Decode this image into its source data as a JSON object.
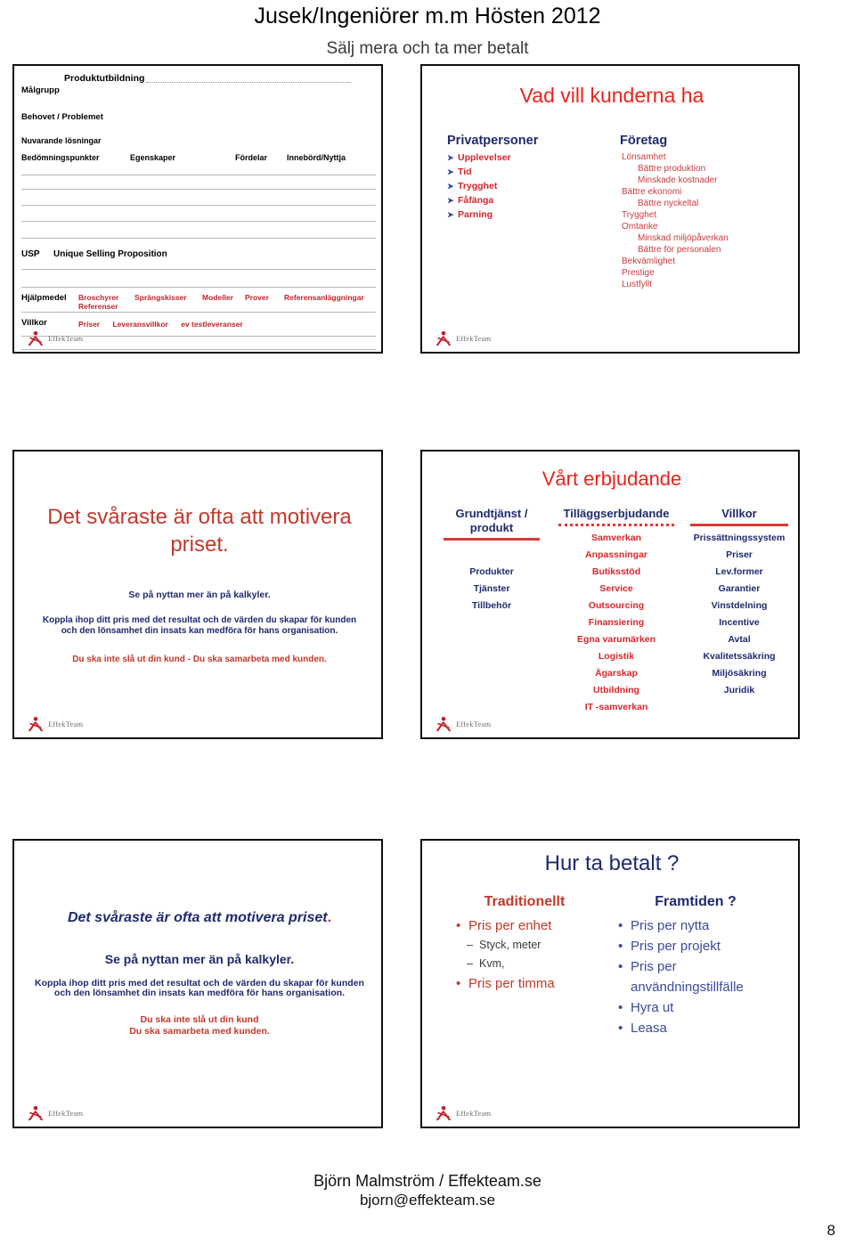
{
  "header": {
    "line1": "Jusek/Ingeniörer m.m Hösten 2012",
    "line2": "Sälj mera och ta mer betalt"
  },
  "logo": {
    "text": "EffekTeam",
    "mark": "person-figure-icon",
    "color": "#c0202a"
  },
  "colors": {
    "red_title": "#e8241c",
    "navy": "#1f2a6e",
    "red_item": "#d9262e",
    "orange_red": "#c0392b",
    "rule_red": "#d63a33"
  },
  "slide1": {
    "product_label": "Produktutbildning",
    "dots": "…………………………………………..",
    "malgrupp": "Målgrupp",
    "behov": "Behovet / Problemet",
    "nuvarande": "Nuvarande lösningar",
    "columns": [
      "Bedömningspunkter",
      "Egenskaper",
      "Fördelar",
      "Innebörd/Nyttja"
    ],
    "usp_abbr": "USP",
    "usp_text": "Unique  Selling  Proposition",
    "hjalpmedel_label": "Hjälpmedel",
    "hjalpmedel_items": [
      "Broschyrer",
      "Sprängskisser",
      "Modeller",
      "Prover",
      "Referensanläggningar",
      "Referenser"
    ],
    "villkor_label": "Villkor",
    "villkor_items": [
      "Priser",
      "Leveransvillkor",
      "ev testleveranser"
    ]
  },
  "slide2": {
    "title": "Vad vill kunderna ha",
    "private": {
      "heading": "Privatpersoner",
      "items": [
        "Upplevelser",
        "Tid",
        "Trygghet",
        "Fåfänga",
        "Parning"
      ]
    },
    "company": {
      "heading": "Företag",
      "items": [
        {
          "text": "Lönsamhet",
          "indent": 0
        },
        {
          "text": "Bättre produktion",
          "indent": 1
        },
        {
          "text": "Minskade kostnader",
          "indent": 1
        },
        {
          "text": "Bättre ekonomi",
          "indent": 0
        },
        {
          "text": "Bättre nyckeltal",
          "indent": 1
        },
        {
          "text": "Trygghet",
          "indent": 0
        },
        {
          "text": "Omtanke",
          "indent": 0
        },
        {
          "text": "Minskad miljöpåverkan",
          "indent": 1
        },
        {
          "text": "Bättre för personalen",
          "indent": 1
        },
        {
          "text": "Bekvämlighet",
          "indent": 0
        },
        {
          "text": "Prestige",
          "indent": 0
        },
        {
          "text": "Lustfyllt",
          "indent": 0
        }
      ]
    }
  },
  "slide3": {
    "title": "Det svåraste är ofta att motivera priset.",
    "subtitle": "Se på nyttan mer än på kalkyler.",
    "body": "Koppla ihop ditt pris med det  resultat och de värden du skapar för kunden och den lönsamhet din insats kan medföra för hans organisation.",
    "footer": "Du ska inte slå ut din kund  - Du ska samarbeta med kunden."
  },
  "slide4": {
    "title": "Vårt erbjudande",
    "col_a": {
      "heading": "Grundtjänst / produkt",
      "rule": "solid",
      "items": [
        "Produkter",
        "Tjänster",
        "Tillbehör"
      ]
    },
    "col_b": {
      "heading": "Tilläggserbjudande",
      "rule": "dotted",
      "items": [
        "Samverkan",
        "Anpassningar",
        "Butiksstöd",
        "Service",
        "Outsourcing",
        "Finansiering",
        "Egna varumärken",
        "Logistik",
        "Ägarskap",
        "Utbildning",
        "IT -samverkan"
      ]
    },
    "col_c": {
      "heading": "Villkor",
      "rule": "solid",
      "items": [
        "Prissättningssystem",
        "Priser",
        "Lev.former",
        "Garantier",
        "Vinstdelning",
        "Incentive",
        "Avtal",
        "Kvalitetssäkring",
        "Miljösäkring",
        "Juridik"
      ]
    }
  },
  "slide5": {
    "title": "Det svåraste är ofta att motivera priset",
    "title_dot": ".",
    "subtitle": "Se på nyttan mer än på kalkyler.",
    "body": "Koppla ihop ditt pris med det  resultat och de värden du skapar för kunden och den lönsamhet din insats kan medföra för hans organisation.",
    "footer_line1": "Du ska inte slå ut din kund",
    "footer_line2": "Du ska samarbeta med kunden."
  },
  "slide6": {
    "title": "Hur ta betalt ?",
    "col_a": {
      "heading": "Traditionellt",
      "items": [
        {
          "text": "Pris per enhet",
          "level": 1
        },
        {
          "text": "Styck, meter",
          "level": 2
        },
        {
          "text": "Kvm,",
          "level": 2
        },
        {
          "text": "Pris per timma",
          "level": 1
        }
      ]
    },
    "col_b": {
      "heading": "Framtiden ?",
      "items": [
        {
          "text": "Pris per nytta",
          "level": 1
        },
        {
          "text": "Pris per projekt",
          "level": 1
        },
        {
          "text": "Pris per användningstillfälle",
          "level": 1
        },
        {
          "text": "Hyra ut",
          "level": 1
        },
        {
          "text": "Leasa",
          "level": 1
        }
      ]
    }
  },
  "footer": {
    "line1": "Björn Malmström / Effekteam.se",
    "line2": "bjorn@effekteam.se",
    "page_number": "8"
  }
}
